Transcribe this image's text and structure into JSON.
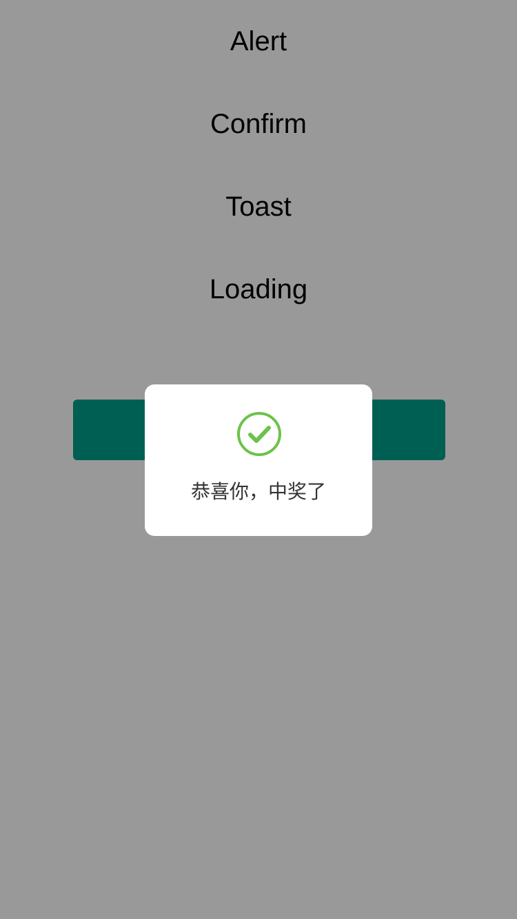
{
  "menu": {
    "items": [
      {
        "label": "Alert"
      },
      {
        "label": "Confirm"
      },
      {
        "label": "Toast"
      },
      {
        "label": "Loading"
      }
    ]
  },
  "primary_button": {
    "color": "#009f8b"
  },
  "toast": {
    "icon": "check-circle-icon",
    "icon_color": "#6cc24a",
    "message": "恭喜你，中奖了"
  },
  "overlay": {
    "color": "rgba(0,0,0,0.4)"
  }
}
